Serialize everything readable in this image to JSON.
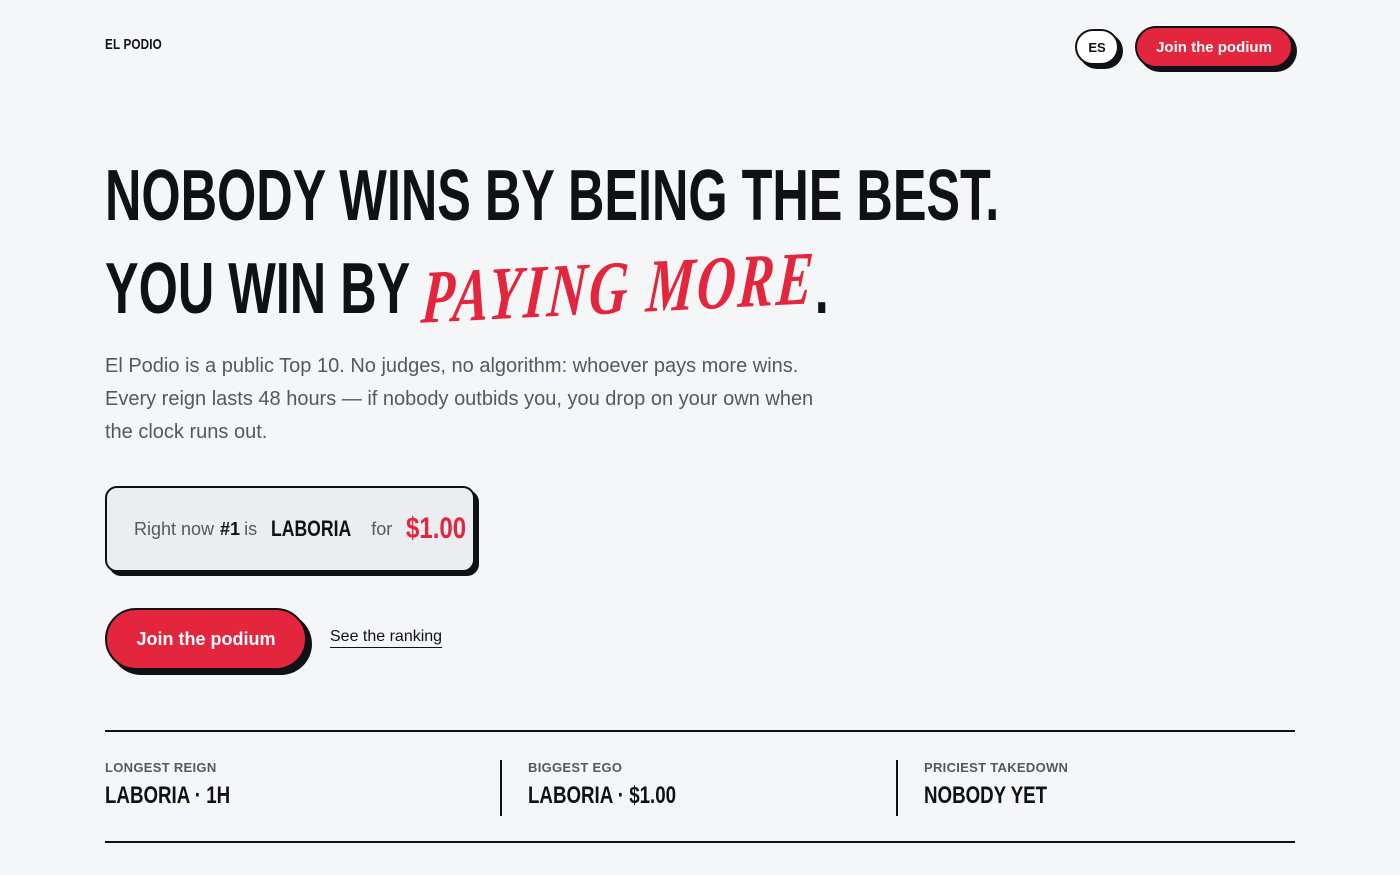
{
  "header": {
    "brand": "EL PODIO",
    "lang_label": "ES",
    "cta_label": "Join the podium"
  },
  "hero": {
    "headline_line1": "NOBODY WINS BY BEING THE BEST.",
    "headline_line2_prefix": "YOU WIN BY",
    "headline_line2_accent": "PAYING MORE",
    "headline_line2_suffix": ".",
    "lead": "El Podio is a public Top 10. No judges, no algorithm: whoever pays more wins. Every reign lasts 48 hours — if nobody outbids you, you drop on your own when the clock runs out."
  },
  "status": {
    "prefix": "Right now",
    "rank": "#1",
    "is": "is",
    "name": "LABORIA",
    "for": "for",
    "price": "$1.00"
  },
  "actions": {
    "cta_label": "Join the podium",
    "ranking_link": "See the ranking"
  },
  "stats": [
    {
      "label": "LONGEST REIGN",
      "value": "LABORIA · 1H"
    },
    {
      "label": "BIGGEST EGO",
      "value": "LABORIA · $1.00"
    },
    {
      "label": "PRICIEST TAKEDOWN",
      "value": "NOBODY YET"
    }
  ],
  "colors": {
    "background": "#f5f6f8",
    "ink": "#0f1117",
    "accent": "#e3263d",
    "muted": "#55585f"
  }
}
